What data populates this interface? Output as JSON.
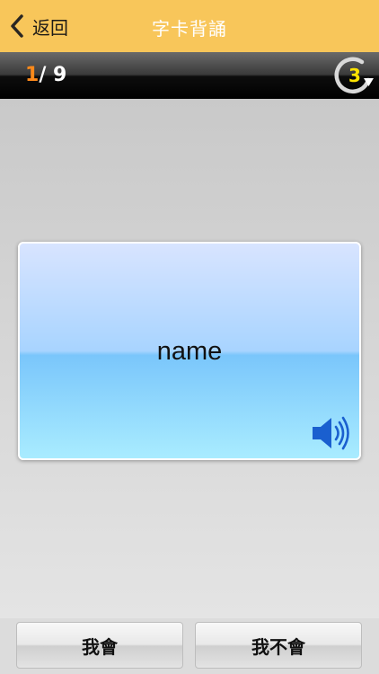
{
  "nav": {
    "back_label": "返回",
    "title": "字卡背誦"
  },
  "progress": {
    "current": "1",
    "separator": "/",
    "total": "9",
    "repeat_count": "3"
  },
  "card": {
    "word": "name"
  },
  "actions": {
    "know_label": "我會",
    "dont_know_label": "我不會"
  },
  "colors": {
    "nav_bg": "#f8c65a",
    "counter_current": "#ff8a1a",
    "repeat_number": "#ffe400"
  },
  "icons": {
    "back": "chevron-left-icon",
    "repeat": "repeat-circle-icon",
    "speaker": "speaker-icon"
  }
}
